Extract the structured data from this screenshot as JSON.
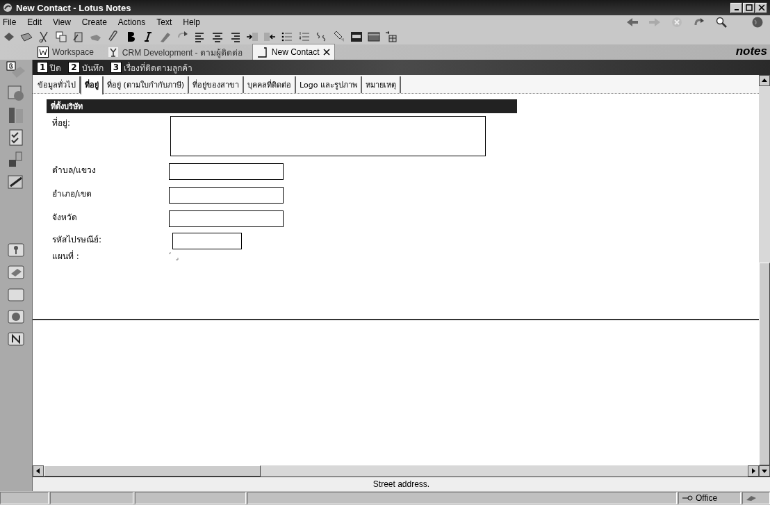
{
  "window": {
    "title": "New Contact - Lotus Notes"
  },
  "menu": [
    "File",
    "Edit",
    "View",
    "Create",
    "Actions",
    "Text",
    "Help"
  ],
  "window_tabs": [
    {
      "label": "Workspace",
      "kind": "workspace",
      "selected": false
    },
    {
      "label": "CRM Development - ตามผู้ติดต่อ",
      "kind": "database",
      "selected": false
    },
    {
      "label": "New Contact",
      "kind": "document",
      "selected": true
    }
  ],
  "brand": "notes",
  "action_bar": [
    {
      "key": "1",
      "label": "ปิด"
    },
    {
      "key": "2",
      "label": "บันทึก"
    },
    {
      "key": "3",
      "label": "เรื่องที่ติดตามลูกค้า"
    }
  ],
  "form_tabs": [
    {
      "label": "ข้อมูลทั่วไป",
      "selected": false
    },
    {
      "label": "ที่อยู่",
      "selected": true
    },
    {
      "label": "ที่อยู่ (ตามใบกำกับภาษี)",
      "selected": false
    },
    {
      "label": "ที่อยู่ของสาขา",
      "selected": false
    },
    {
      "label": "บุคคลที่ติดต่อ",
      "selected": false
    },
    {
      "label": "Logo และรูปภาพ",
      "selected": false
    },
    {
      "label": "หมายเหตุ",
      "selected": false
    }
  ],
  "section": {
    "title": "ที่ตั้งบริษัท"
  },
  "fields": [
    {
      "label": "ที่อยู่:",
      "kind": "textarea"
    },
    {
      "label": "ตำบล/แขวง",
      "kind": "text"
    },
    {
      "label": "อำเภอ/เขต",
      "kind": "text"
    },
    {
      "label": "จังหวัด",
      "kind": "text"
    },
    {
      "label": "รหัสไปรษณีย์:",
      "kind": "short"
    },
    {
      "label": "แผนที่ :",
      "kind": "map"
    }
  ],
  "status_line": "Street address.",
  "status_bar": {
    "location": "Office"
  }
}
